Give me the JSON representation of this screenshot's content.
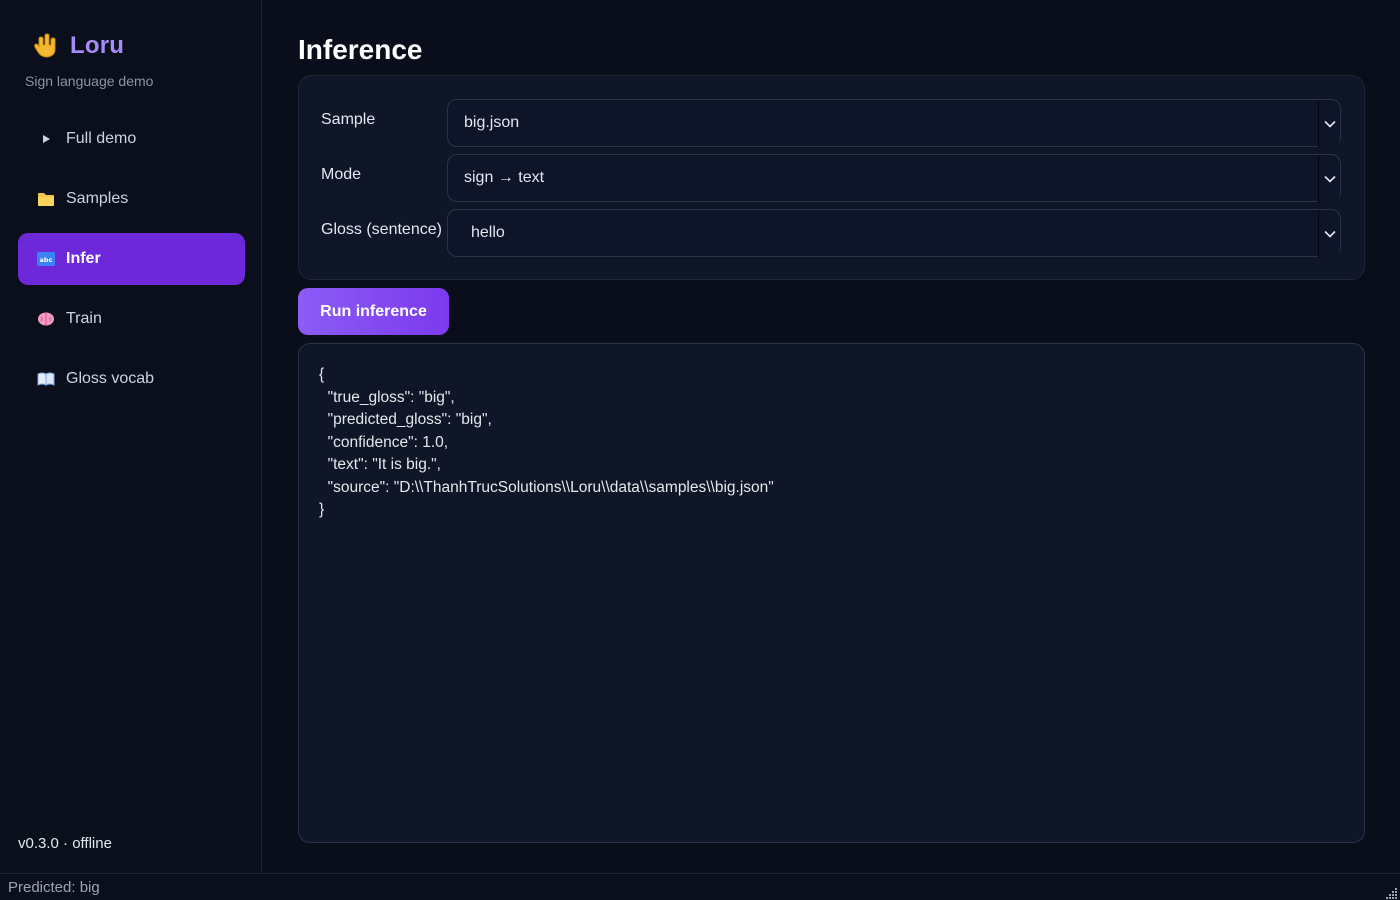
{
  "brand": {
    "title": "Loru",
    "subtitle": "Sign language demo",
    "logo_icon": "sign-hand-icon"
  },
  "nav": {
    "items": [
      {
        "label": "Full demo",
        "icon": "play-triangle-icon",
        "active": false
      },
      {
        "label": "Samples",
        "icon": "folder-icon",
        "active": false
      },
      {
        "label": "Infer",
        "icon": "abc-icon",
        "active": true
      },
      {
        "label": "Train",
        "icon": "brain-icon",
        "active": false
      },
      {
        "label": "Gloss vocab",
        "icon": "book-icon",
        "active": false
      }
    ]
  },
  "footer": {
    "version": "v0.3.0 · offline"
  },
  "main": {
    "title": "Inference",
    "form": {
      "sample_label": "Sample",
      "sample_value": "big.json",
      "mode_label": "Mode",
      "mode_value": "sign → text",
      "gloss_label": "Gloss (sentence)",
      "gloss_value": "hello"
    },
    "run_label": "Run inference",
    "output": "{\n  \"true_gloss\": \"big\",\n  \"predicted_gloss\": \"big\",\n  \"confidence\": 1.0,\n  \"text\": \"It is big.\",\n  \"source\": \"D:\\\\ThanhTrucSolutions\\\\Loru\\\\data\\\\samples\\\\big.json\"\n}"
  },
  "status": {
    "text": "Predicted: big"
  },
  "colors": {
    "accent": "#6d28d9",
    "brand": "#a78bfa",
    "background": "#0a0e1a",
    "card": "#0f1627"
  }
}
